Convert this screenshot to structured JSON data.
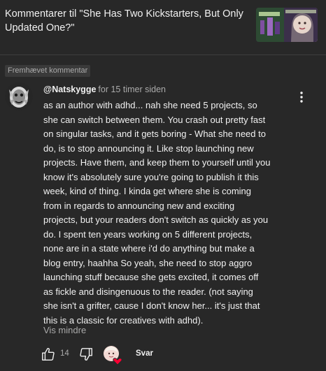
{
  "header": {
    "title": "Kommentarer til \"She Has Two Kickstarters, But Only Updated One?\""
  },
  "comment": {
    "pinned_label": "Fremhævet kommentar",
    "author": "@Natskygge",
    "timestamp": "for 15 timer siden",
    "text": "as an author with adhd... nah she need 5 projects, so\nshe can switch between them. You crash out pretty fast\non singular tasks, and it gets boring - What she need to\ndo, is to stop announcing it. Like stop launching new\nprojects. Have them, and keep them to yourself until you\nknow it's absolutely sure you're going to publish it this\nweek, kind of thing.  I kinda get where she is coming\nfrom in regards to announcing new and exciting\nprojects, but your readers don't switch as quickly as you\ndo. I spent ten years working on 5 different projects,\nnone are in a state where i'd do anything but make a\nblog entry, haahha  So yeah, she need to stop aggro\nlaunching stuff because she gets excited, it comes off\nas fickle and disingenuous to the reader.  (not saying\nshe isn't a grifter, cause I don't know her... it's just that\nthis is a classic for creatives with adhd).",
    "show_less_label": "Vis mindre",
    "like_count": "14",
    "reply_label": "Svar"
  },
  "icons": {
    "like": "thumb-up-icon",
    "dislike": "thumb-down-icon",
    "more": "more-vert-icon",
    "creator_heart": "creator-heart-icon"
  },
  "colors": {
    "background": "#282828",
    "text_primary": "#f1f1f1",
    "text_secondary": "#aaaaaa",
    "heart": "#ff0033"
  }
}
